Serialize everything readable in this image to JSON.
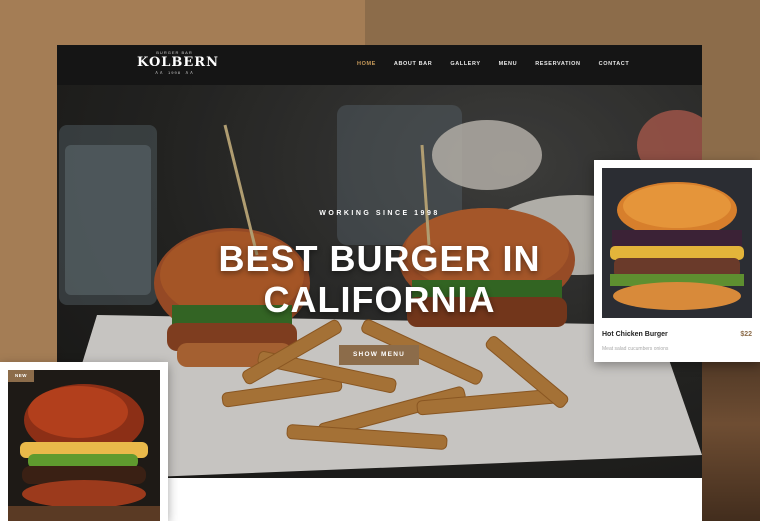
{
  "brand": {
    "tagline_top": "BURGER BAR",
    "name": "KOLBERN",
    "year": "1998"
  },
  "nav": {
    "items": [
      {
        "label": "HOME",
        "active": true
      },
      {
        "label": "ABOUT BAR",
        "active": false
      },
      {
        "label": "GALLERY",
        "active": false
      },
      {
        "label": "MENU",
        "active": false
      },
      {
        "label": "RESERVATION",
        "active": false
      },
      {
        "label": "CONTACT",
        "active": false
      }
    ]
  },
  "hero": {
    "kicker": "WORKING SINCE 1998",
    "headline_line1": "BEST BURGER IN",
    "headline_line2": "CALIFORNIA",
    "cta_label": "SHOW MENU"
  },
  "product_card": {
    "name": "Hot Chicken Burger",
    "price": "$22",
    "description": "Meat salad cucumbers onions"
  },
  "new_card": {
    "badge": "NEW"
  },
  "colors": {
    "accent": "#8c6c4a",
    "nav_active": "#c79a5a",
    "navbar_bg": "#151515",
    "page_bg_left": "#a47d55",
    "page_bg_right": "#8c6c4a"
  }
}
